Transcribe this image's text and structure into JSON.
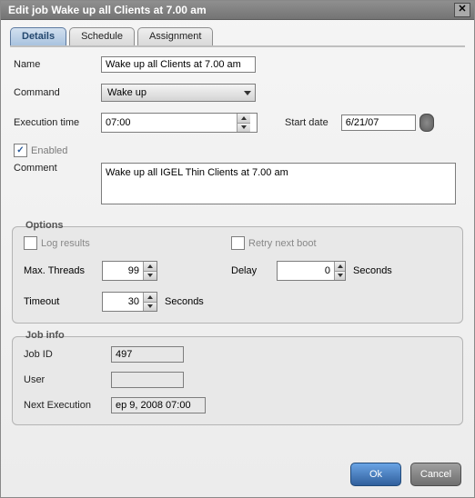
{
  "window": {
    "title": "Edit job Wake up all Clients at 7.00 am"
  },
  "tabs": {
    "details": "Details",
    "schedule": "Schedule",
    "assignment": "Assignment",
    "active": "details"
  },
  "labels": {
    "name": "Name",
    "command": "Command",
    "execution_time": "Execution time",
    "start_date": "Start date",
    "enabled": "Enabled",
    "comment": "Comment",
    "options_legend": "Options",
    "log_results": "Log results",
    "retry_next_boot": "Retry next boot",
    "max_threads": "Max. Threads",
    "delay": "Delay",
    "seconds": "Seconds",
    "timeout": "Timeout",
    "job_info_legend": "Job info",
    "job_id": "Job ID",
    "user": "User",
    "next_execution": "Next Execution"
  },
  "values": {
    "name": "Wake up all Clients at 7.00 am",
    "command": "Wake up",
    "execution_time": "07:00",
    "start_date": "6/21/07",
    "enabled": true,
    "comment": "Wake up all IGEL Thin Clients at 7.00 am",
    "log_results": false,
    "retry_next_boot": false,
    "max_threads": "99",
    "delay": "0",
    "timeout": "30",
    "job_id": "497",
    "user": "",
    "next_execution": "ep 9, 2008 07:00"
  },
  "buttons": {
    "ok": "Ok",
    "cancel": "Cancel"
  }
}
